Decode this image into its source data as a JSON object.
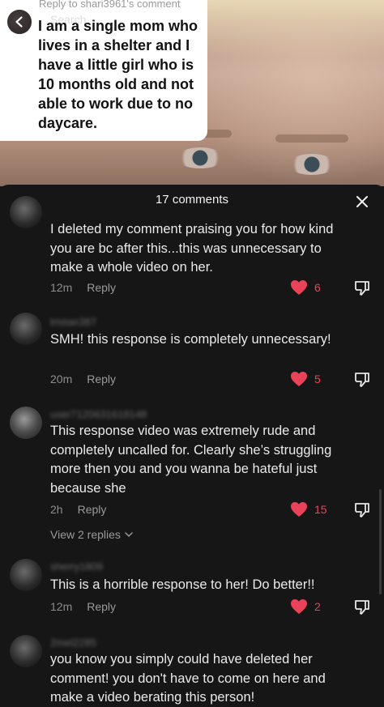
{
  "video": {
    "reply_header": "Reply to shari3961's comment",
    "search_hint": "Search",
    "reply_text": "I am a single mom who lives in a shelter and I have a little girl who is 10 months old and not able to work due to no daycare."
  },
  "sheet": {
    "title": "17 comments"
  },
  "colors": {
    "like_active": "#ea4359",
    "background": "#161616"
  },
  "comments": [
    {
      "username": "",
      "text": "I deleted my comment praising you for how kind you are bc after this...this was unnecessary to make a whole video on her.",
      "time": "12m",
      "reply_label": "Reply",
      "likes": "6"
    },
    {
      "username": "tristan387",
      "text": "SMH! this response is completely unnecessary!",
      "time": "20m",
      "reply_label": "Reply",
      "likes": "5"
    },
    {
      "username": "user7120631618148",
      "text": "This response video was extremely rude and completely uncalled for. Clearly she’s struggling more then you and you wanna be hateful just because she",
      "time": "2h",
      "reply_label": "Reply",
      "likes": "15",
      "view_replies": "View 2 replies"
    },
    {
      "username": "sherry1809",
      "text": "This is a horrible response to her! Do better!!",
      "time": "12m",
      "reply_label": "Reply",
      "likes": "2"
    },
    {
      "username": "2mel2285",
      "text": "you know you simply could have deleted her comment! you don't have to come on here and make a video berating this person!",
      "time": "",
      "reply_label": "",
      "likes": ""
    }
  ]
}
